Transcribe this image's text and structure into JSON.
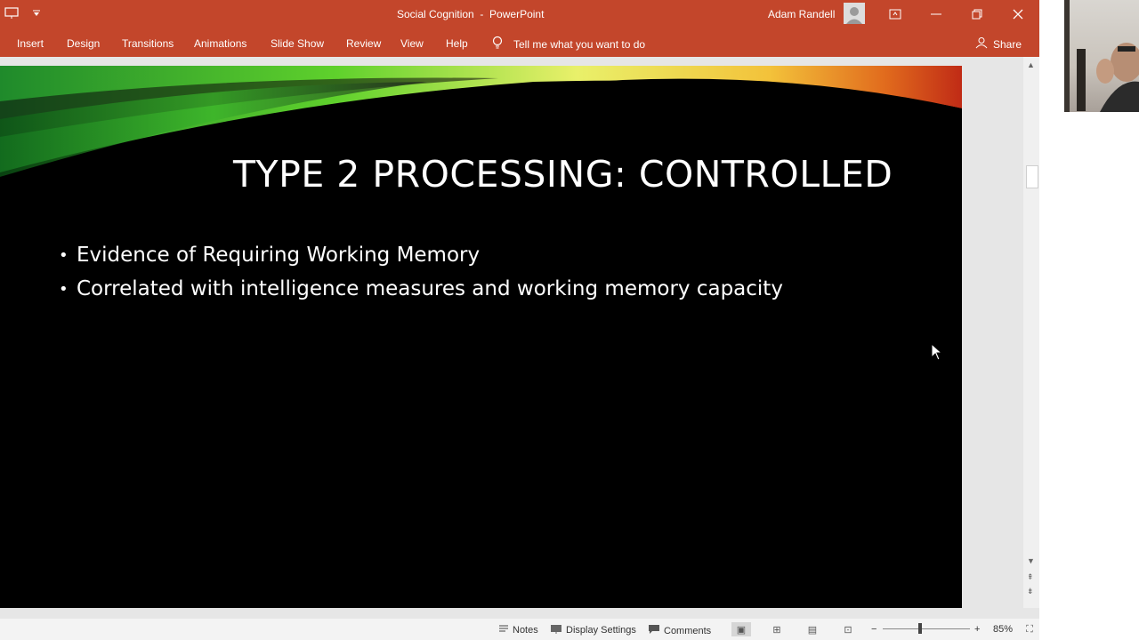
{
  "app": {
    "document_title": "Social Cognition  -  PowerPoint",
    "user_name": "Adam Randell"
  },
  "ribbon": {
    "tabs": [
      "Insert",
      "Design",
      "Transitions",
      "Animations",
      "Slide Show",
      "Review",
      "View",
      "Help"
    ],
    "tell_me": "Tell me what you want to do",
    "share": "Share"
  },
  "slide": {
    "title": "TYPE 2 PROCESSING: CONTROLLED",
    "bullets": [
      "Evidence of Requiring Working Memory",
      "Correlated with intelligence measures and working memory capacity"
    ]
  },
  "statusbar": {
    "notes": "Notes",
    "display_settings": "Display Settings",
    "comments": "Comments",
    "zoom": "85%"
  },
  "colors": {
    "ribbon": "#c3462b",
    "slide_bg": "#000000"
  },
  "icons": [
    "presentation-icon",
    "quick-access-dropdown-icon",
    "account-icon",
    "ribbon-display-icon",
    "minimize-icon",
    "restore-icon",
    "close-icon",
    "lightbulb-icon",
    "share-person-icon",
    "notes-icon",
    "display-settings-icon",
    "comments-icon",
    "normal-view-icon",
    "slide-sorter-icon",
    "reading-view-icon",
    "slideshow-icon",
    "zoom-out-icon",
    "zoom-in-icon",
    "fit-slide-icon",
    "mouse-cursor-icon"
  ]
}
